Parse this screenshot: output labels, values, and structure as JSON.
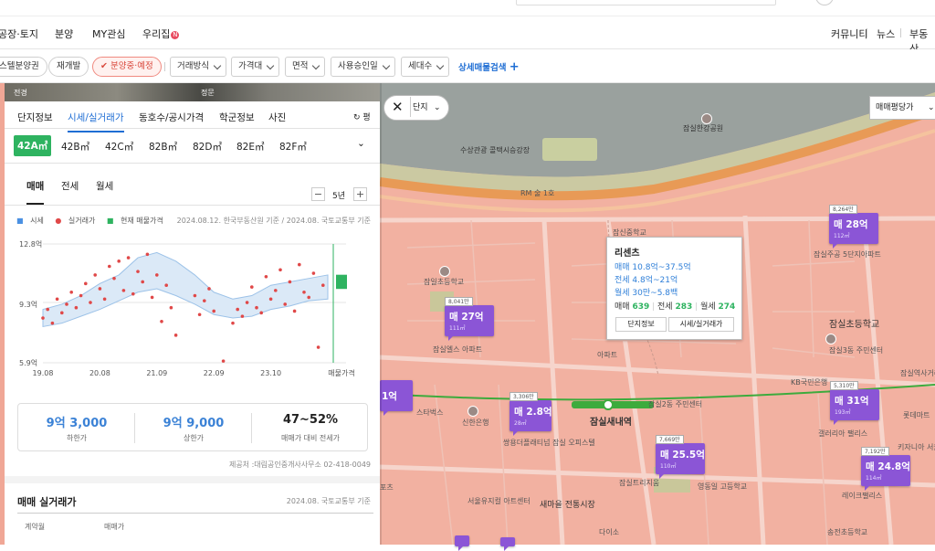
{
  "nav": {
    "items": [
      "공장·토지",
      "분양",
      "MY관심",
      "우리집"
    ],
    "new_badge": "N",
    "right_items": [
      "커뮤니티",
      "뉴스",
      "부동산"
    ]
  },
  "filters": {
    "chips": [
      "스텔분양권",
      "재개발",
      "분양중·예정"
    ],
    "selects": [
      "거래방식",
      "가격대",
      "면적",
      "사용승인일",
      "세대수"
    ],
    "advanced": "상세매물검색",
    "plus": "+"
  },
  "photo": {
    "left_label": "전경",
    "right_label": "정문"
  },
  "tabs": {
    "main": [
      "단지정보",
      "시세/실거래가",
      "동호수/공시가격",
      "학군정보",
      "사진"
    ],
    "active_main": 1,
    "types": [
      "42A㎡",
      "42B㎡",
      "42C㎡",
      "82B㎡",
      "82D㎡",
      "82E㎡",
      "82F㎡"
    ],
    "trade": [
      "매매",
      "전세",
      "월세"
    ],
    "period": "5년",
    "minus": "−",
    "plus": "+",
    "refresh": "평"
  },
  "legend": {
    "items": [
      "시세",
      "실거래가",
      "현재 매물가격"
    ],
    "source": "2024.08.12. 한국부동산원 기준 / 2024.08. 국토교통부 기준"
  },
  "chart_data": {
    "type": "scatter",
    "title": "",
    "y_ticks": [
      "12.8억",
      "9.3억",
      "5.9억"
    ],
    "x_ticks": [
      "19.08",
      "20.08",
      "21.09",
      "22.09",
      "23.10",
      "매물가격"
    ],
    "ylim": [
      5.9,
      12.8
    ],
    "series": [
      {
        "name": "시세",
        "type": "area",
        "x": [
          0,
          4,
          8,
          12,
          16,
          20,
          24,
          28,
          32,
          36,
          40,
          44,
          48,
          52,
          56,
          60
        ],
        "low": [
          8.0,
          8.2,
          8.6,
          9.0,
          9.5,
          10.0,
          10.2,
          9.8,
          9.3,
          8.7,
          8.5,
          8.6,
          9.0,
          9.2,
          9.5,
          9.6
        ],
        "high": [
          9.0,
          9.3,
          9.8,
          10.5,
          11.0,
          12.0,
          12.3,
          11.8,
          11.0,
          10.0,
          9.6,
          9.8,
          10.4,
          10.6,
          10.8,
          11.0
        ]
      },
      {
        "name": "실거래가",
        "type": "scatter",
        "x": [
          0,
          1,
          2,
          3,
          4,
          5,
          6,
          7,
          8,
          9,
          10,
          11,
          12,
          13,
          14,
          15,
          16,
          17,
          18,
          19,
          20,
          21,
          22,
          23,
          24,
          25,
          26,
          27,
          28,
          32,
          33,
          34,
          35,
          36,
          38,
          40,
          41,
          42,
          43,
          44,
          45,
          46,
          47,
          48,
          49,
          50,
          51,
          52,
          53,
          54,
          55,
          56,
          57,
          58,
          59
        ],
        "y": [
          8.5,
          9.0,
          8.2,
          9.6,
          8.8,
          9.3,
          10.0,
          9.1,
          9.8,
          10.5,
          9.4,
          11.0,
          10.2,
          9.6,
          11.5,
          10.8,
          11.8,
          10.1,
          12.0,
          9.9,
          11.2,
          10.6,
          12.2,
          9.7,
          11.0,
          8.3,
          10.4,
          9.1,
          7.5,
          9.8,
          8.7,
          9.5,
          10.2,
          8.9,
          6.0,
          8.2,
          9.0,
          8.6,
          9.4,
          10.3,
          9.1,
          8.8,
          10.9,
          9.6,
          10.1,
          11.3,
          9.3,
          10.6,
          8.9,
          11.6,
          10.0,
          9.7,
          11.1,
          6.8,
          10.4
        ]
      },
      {
        "name": "현재 매물가격",
        "type": "bar",
        "low": 10.4,
        "high": 10.8
      }
    ]
  },
  "stats": [
    {
      "value": "9억 3,000",
      "label": "하한가"
    },
    {
      "value": "9억 9,000",
      "label": "상한가"
    },
    {
      "value": "47~52%",
      "label": "매매가 대비 전세가"
    }
  ],
  "provider": "제공처 :대림공인중개사사무소 02-418-0049",
  "trade_section": {
    "title": "매매 실거래가",
    "source": "2024.08. 국토교통부 기준",
    "cols": [
      "계약월",
      "매매가"
    ]
  },
  "map": {
    "selector": "단지",
    "price_mode": "매매평당가",
    "labels": [
      "수상관광 콜택시승강장",
      "잠실한강공원",
      "RM 술 1호",
      "잠신중학교",
      "잠일초등학교",
      "잠실엘스 아파트",
      "아파트",
      "잠실주공 5단지아파트",
      "잠실3동 주민센터",
      "잠실초등학교",
      "KB국민은행",
      "잠실역사거리",
      "신한은행",
      "잠실새내역",
      "잠실2동 주민센터",
      "스타벅스",
      "쌍용더플래티넘 잠실 오피스텔",
      "잠실트리지움",
      "영동일 고등학교",
      "갤러리아 팰리스",
      "키자니아 서울",
      "롯데마트",
      "서울유지컬 아트센터",
      "새마을 전통시장",
      "다이소",
      "레이크팰리스",
      "송전초등학교",
      "포츠"
    ],
    "markers": [
      {
        "count": "8,041만",
        "price": "매 27억",
        "area": "111㎡"
      },
      {
        "count": "8,264만",
        "price": "매 28억",
        "area": "112㎡"
      },
      {
        "count": "3,306만",
        "price": "매 2.8억",
        "area": "28㎡"
      },
      {
        "count": "5,310만",
        "price": "매 31억",
        "area": "193㎡"
      },
      {
        "count": "7,669만",
        "price": "매 25.5억",
        "area": "110㎡"
      },
      {
        "count": "7,192만",
        "price": "매 24.8억",
        "area": "114㎡"
      },
      {
        "count": "",
        "price": "1억",
        "area": ""
      }
    ],
    "popup": {
      "title": "리센츠",
      "sale": "매매 10.8억~37.5억",
      "jeonse": "전세 4.8억~21억",
      "wolse": "월세 30만~5.8백",
      "counts": {
        "sale_label": "매매",
        "sale": "639",
        "jeonse_label": "전세",
        "jeonse": "283",
        "wolse_label": "월세",
        "wolse": "274"
      },
      "btn1": "단지정보",
      "btn2": "시세/실거래가"
    }
  }
}
